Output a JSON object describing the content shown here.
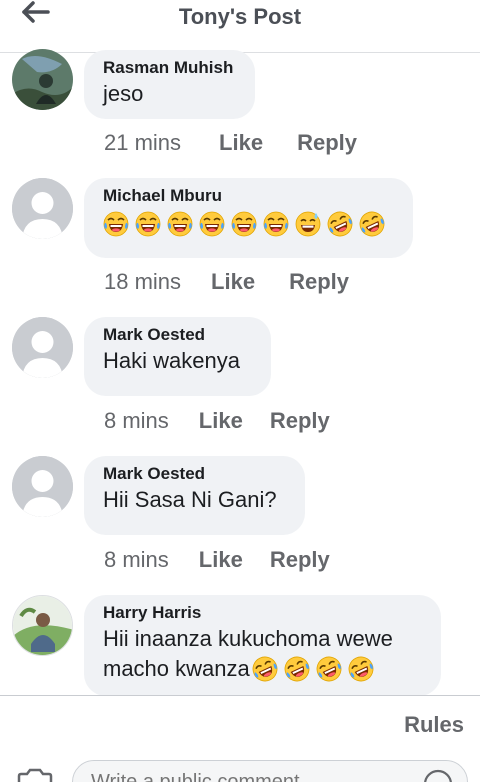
{
  "header": {
    "title": "Tony's Post"
  },
  "comments": [
    {
      "author": "Rasman Muhish",
      "text": "jeso",
      "time": "21 mins",
      "like": "Like",
      "reply": "Reply"
    },
    {
      "author": "Michael Mburu",
      "emojis": [
        "laughing-tears-face",
        "laughing-tears-face",
        "laughing-tears-face",
        "laughing-tears-face",
        "laughing-tears-face",
        "laughing-tears-face",
        "sweat-smile-face",
        "rofl-face",
        "rofl-face"
      ],
      "time": "18 mins",
      "like": "Like",
      "reply": "Reply"
    },
    {
      "author": "Mark Oested",
      "text": "Haki wakenya",
      "time": "8 mins",
      "like": "Like",
      "reply": "Reply"
    },
    {
      "author": "Mark Oested",
      "text": "Hii Sasa Ni Gani?",
      "time": "8 mins",
      "like": "Like",
      "reply": "Reply"
    },
    {
      "author": "Harry Harris",
      "text_line1": "Hii inaanza kukuchoma wewe",
      "text_line2": "macho kwanza",
      "trailing_emojis": [
        "rofl-face",
        "rofl-face",
        "rofl-face",
        "rofl-face"
      ]
    }
  ],
  "footer": {
    "rules_label": "Rules",
    "composer_placeholder": "Write a public comment..."
  },
  "colors": {
    "bubble": "#f0f2f5",
    "muted": "#65676b",
    "text": "#1c1e21"
  }
}
